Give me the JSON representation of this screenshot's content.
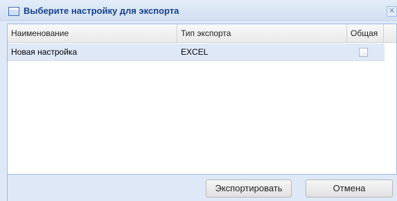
{
  "dialog": {
    "title": "Выберите настройку для экспорта",
    "close_glyph": "✕"
  },
  "grid": {
    "columns": [
      "Наименование",
      "Тип экспорта",
      "Общая"
    ],
    "rows": [
      {
        "name": "Новая настройка",
        "export_type": "EXCEL",
        "shared": false
      }
    ]
  },
  "buttons": {
    "export_label": "Экспортировать",
    "cancel_label": "Отмена"
  },
  "colors": {
    "title_text": "#15428b",
    "selected_row": "#dfe8f6",
    "border": "#99bbe8"
  }
}
